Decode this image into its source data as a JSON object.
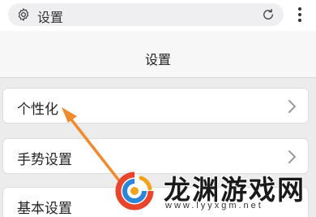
{
  "browser": {
    "title": "设置",
    "icons": {
      "site": "gear-icon",
      "reload": "reload-icon",
      "menu": "more-vertical-icon"
    }
  },
  "page": {
    "heading": "设置"
  },
  "settings_items": [
    {
      "label": "个性化"
    },
    {
      "label": "手势设置"
    },
    {
      "label": "基本设置"
    }
  ],
  "annotation": {
    "color": "#f08a2c"
  },
  "watermark": {
    "brand": "龙渊游戏网",
    "url": "www.lyyxgm.net"
  }
}
